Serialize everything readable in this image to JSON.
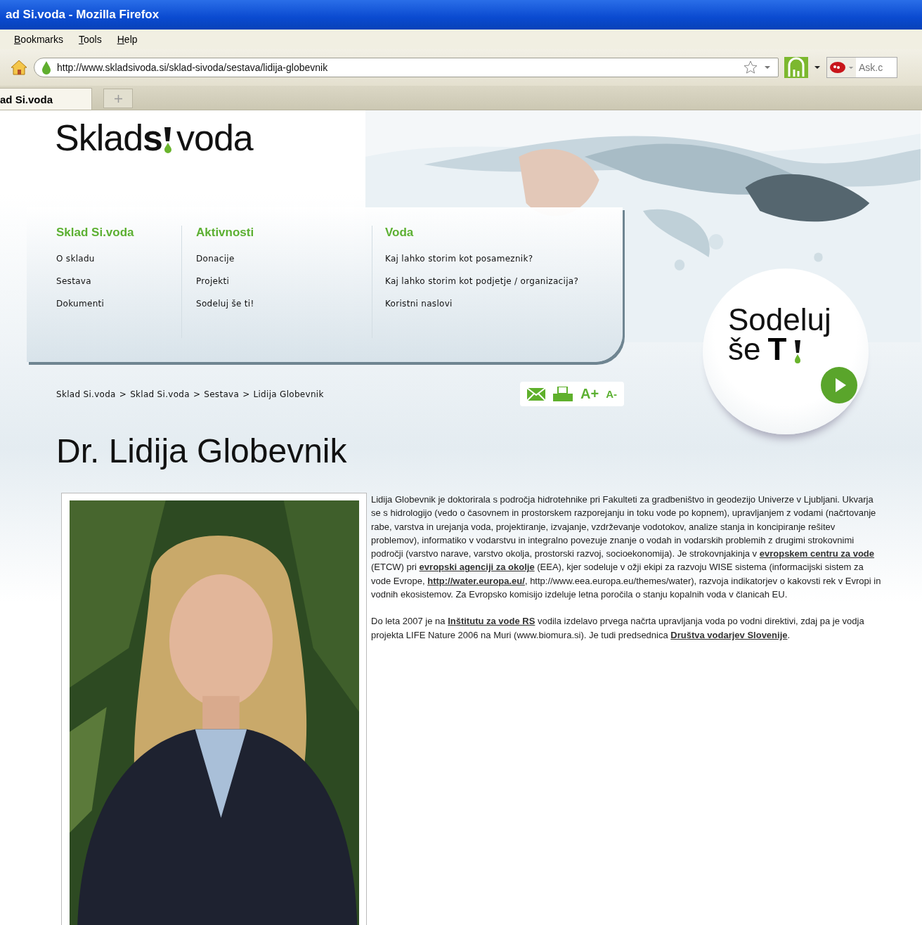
{
  "window": {
    "title": "ad Si.voda - Mozilla Firefox"
  },
  "menu": [
    "Bookmarks",
    "Tools",
    "Help"
  ],
  "address_bar": {
    "url": "http://www.skladsivoda.si/sklad-sivoda/sestava/lidija-globevnik"
  },
  "search": {
    "placeholder": "Ask.c"
  },
  "tabs": [
    {
      "label": "ad Si.voda",
      "selected": true
    }
  ],
  "logo": {
    "before": "Sklad",
    "middle": "s",
    "after": "voda"
  },
  "nav_columns": [
    {
      "heading": "Sklad Si.voda",
      "items": [
        "O skladu",
        "Sestava",
        "Dokumenti"
      ]
    },
    {
      "heading": "Aktivnosti",
      "items": [
        "Donacije",
        "Projekti",
        "Sodeluj še ti!"
      ]
    },
    {
      "heading": "Voda",
      "items": [
        "Kaj lahko storim kot posameznik?",
        "Kaj lahko storim kot podjetje / organizacija?",
        "Koristni naslovi"
      ]
    }
  ],
  "promo": {
    "line1": "Sodeluj",
    "line2": "še",
    "emphasis": "T"
  },
  "breadcrumb": [
    "Sklad Si.voda",
    "Sklad Si.voda",
    "Sestava",
    "Lidija Globevnik"
  ],
  "breadcrumb_separator": ">",
  "tools": [
    {
      "kind": "mail"
    },
    {
      "kind": "print"
    },
    {
      "kind": "text",
      "label": "A+"
    },
    {
      "kind": "text",
      "label": "A-"
    }
  ],
  "heading": "Dr. Lidija Globevnik",
  "photo": {
    "kind": "picture"
  },
  "paragraphs": [
    [
      {
        "text": "Lidija Globevnik je doktorirala s področja hidrotehnike pri Fakulteti za gradbeništvo in geodezijo Univerze v Ljubljani. Ukvarja se s hidrologijo (vedo o časovnem in prostorskem razporejanju in toku vode po kopnem), upravljanjem z vodami (načrtovanje rabe, varstva in urejanja voda, projektiranje, izvajanje, vzdrževanje vodotokov, analize stanja in koncipiranje rešitev problemov), informatiko v vodarstvu in integralno povezuje znanje o vodah in vodarskih problemih z drugimi strokovnimi področji (varstvo narave, varstvo okolja, prostorski razvoj, socioekonomija). Je strokovnjakinja v ",
        "kind": "text"
      },
      {
        "text": "evropskem centru za vode",
        "kind": "link"
      },
      {
        "text": " (ETCW) pri ",
        "kind": "text"
      },
      {
        "text": "evropski agenciji za okolje",
        "kind": "link"
      },
      {
        "text": " (EEA), kjer sodeluje v ožji ekipi za razvoju WISE sistema (informacijski sistem za vode Evrope, ",
        "kind": "text"
      },
      {
        "text": "http://water.europa.eu/",
        "kind": "link"
      },
      {
        "text": ", http://www.eea.europa.eu/themes/water), razvoja indikatorjev o kakovsti rek v Evropi in vodnih ekosistemov. Za Evropsko komisijo izdeluje letna poročila o stanju kopalnih voda v članicah EU.",
        "kind": "text"
      }
    ],
    [
      {
        "text": "Do leta 2007 je na ",
        "kind": "text"
      },
      {
        "text": "Inštitutu za vode RS",
        "kind": "link"
      },
      {
        "text": " vodila izdelavo prvega načrta upravljanja voda po vodni direktivi, zdaj pa je vodja projekta LIFE Nature 2006 na Muri (www.biomura.si). Je tudi predsednica ",
        "kind": "text"
      },
      {
        "text": "Društva vodarjev Slovenije",
        "kind": "link"
      },
      {
        "text": ".",
        "kind": "text"
      }
    ]
  ]
}
